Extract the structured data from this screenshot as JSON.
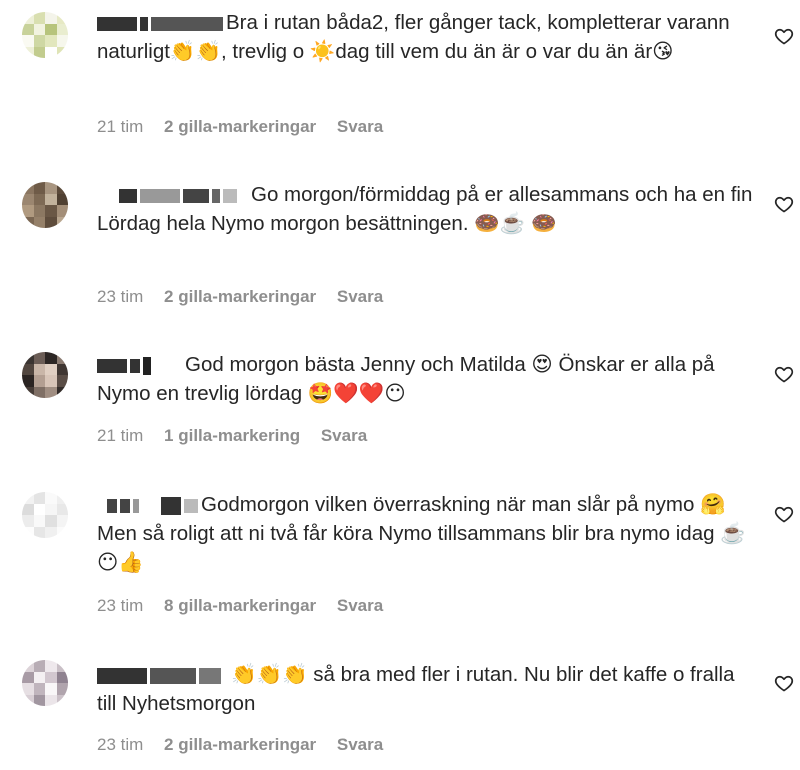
{
  "comments": [
    {
      "text": "Bra i rutan båda2, fler gånger tack, kompletterar varann naturligt👏👏, trevlig o ☀️dag till vem du än är o var du än är😘",
      "time": "21 tim",
      "likes": "2 gilla-markeringar",
      "reply": "Svara",
      "avatar_colors": [
        "#eef0d8",
        "#d9dfb0",
        "#f4f4ea",
        "#e6e9c4",
        "#c8d29a",
        "#f2f3e0",
        "#b7c47c",
        "#e9edcf",
        "#fafaf2",
        "#cfd8a4",
        "#e2e7bd",
        "#f6f7ec",
        "#eef0d8",
        "#c2cc8e",
        "#ffffff",
        "#dfe4b6"
      ]
    },
    {
      "text": "Go morgon/förmiddag på er allesammans och ha en fin Lördag hela Nymo morgon besättningen. 🍩☕️ 🍩",
      "time": "23 tim",
      "likes": "2 gilla-markeringar",
      "reply": "Svara",
      "avatar_colors": [
        "#8a7560",
        "#6f5b48",
        "#a89580",
        "#5b4a3a",
        "#9b8670",
        "#7e6a55",
        "#c2b29c",
        "#4f4032",
        "#b09a80",
        "#8c7862",
        "#6a5745",
        "#a38e78",
        "#7a6652",
        "#958069",
        "#5e4c3c",
        "#b8a58e"
      ]
    },
    {
      "text": "God morgon bästa Jenny och Matilda 😍 Önskar er alla på Nymo en trevlig lördag 🤩❤️❤️😶",
      "time": "21 tim",
      "likes": "1 gilla-markering",
      "reply": "Svara",
      "avatar_colors": [
        "#3a3431",
        "#6b5d56",
        "#2c2624",
        "#8a7a70",
        "#51463f",
        "#c9b6a8",
        "#e0cfc2",
        "#3f3632",
        "#2a2422",
        "#b39f92",
        "#d8c5b8",
        "#5a4d46",
        "#463c37",
        "#7f6f65",
        "#a08e82",
        "#332c29"
      ]
    },
    {
      "text": "Godmorgon vilken överraskning när man slår på nymo 🤗Men så roligt att ni två får köra Nymo tillsammans blir bra nymo idag ☕️😶👍",
      "time": "23 tim",
      "likes": "8 gilla-markeringar",
      "reply": "Svara",
      "avatar_colors": [
        "#f2f2f2",
        "#e4e4e4",
        "#fafafa",
        "#efefef",
        "#dcdcdc",
        "#ffffff",
        "#f6f6f6",
        "#e8e8e8",
        "#ececec",
        "#f9f9f9",
        "#e0e0e0",
        "#f4f4f4",
        "#fdfdfd",
        "#e6e6e6",
        "#f0f0f0",
        "#fbfbfb"
      ]
    },
    {
      "text": "👏👏👏 så bra med fler i rutan. Nu blir det kaffe o fralla till Nyhetsmorgon",
      "time": "23 tim",
      "likes": "2 gilla-markeringar",
      "reply": "Svara",
      "avatar_colors": [
        "#dcd3d8",
        "#b8adb5",
        "#eee8ec",
        "#c9bfc6",
        "#a89ba5",
        "#f4f0f2",
        "#d2c7cf",
        "#8f8290",
        "#e6dfe3",
        "#c0b5bd",
        "#f9f7f8",
        "#b0a4ad",
        "#d8cfd5",
        "#a196a0",
        "#ebe5e9",
        "#cbc1c8"
      ]
    }
  ],
  "icons": {
    "like": "heart-outline-icon"
  }
}
